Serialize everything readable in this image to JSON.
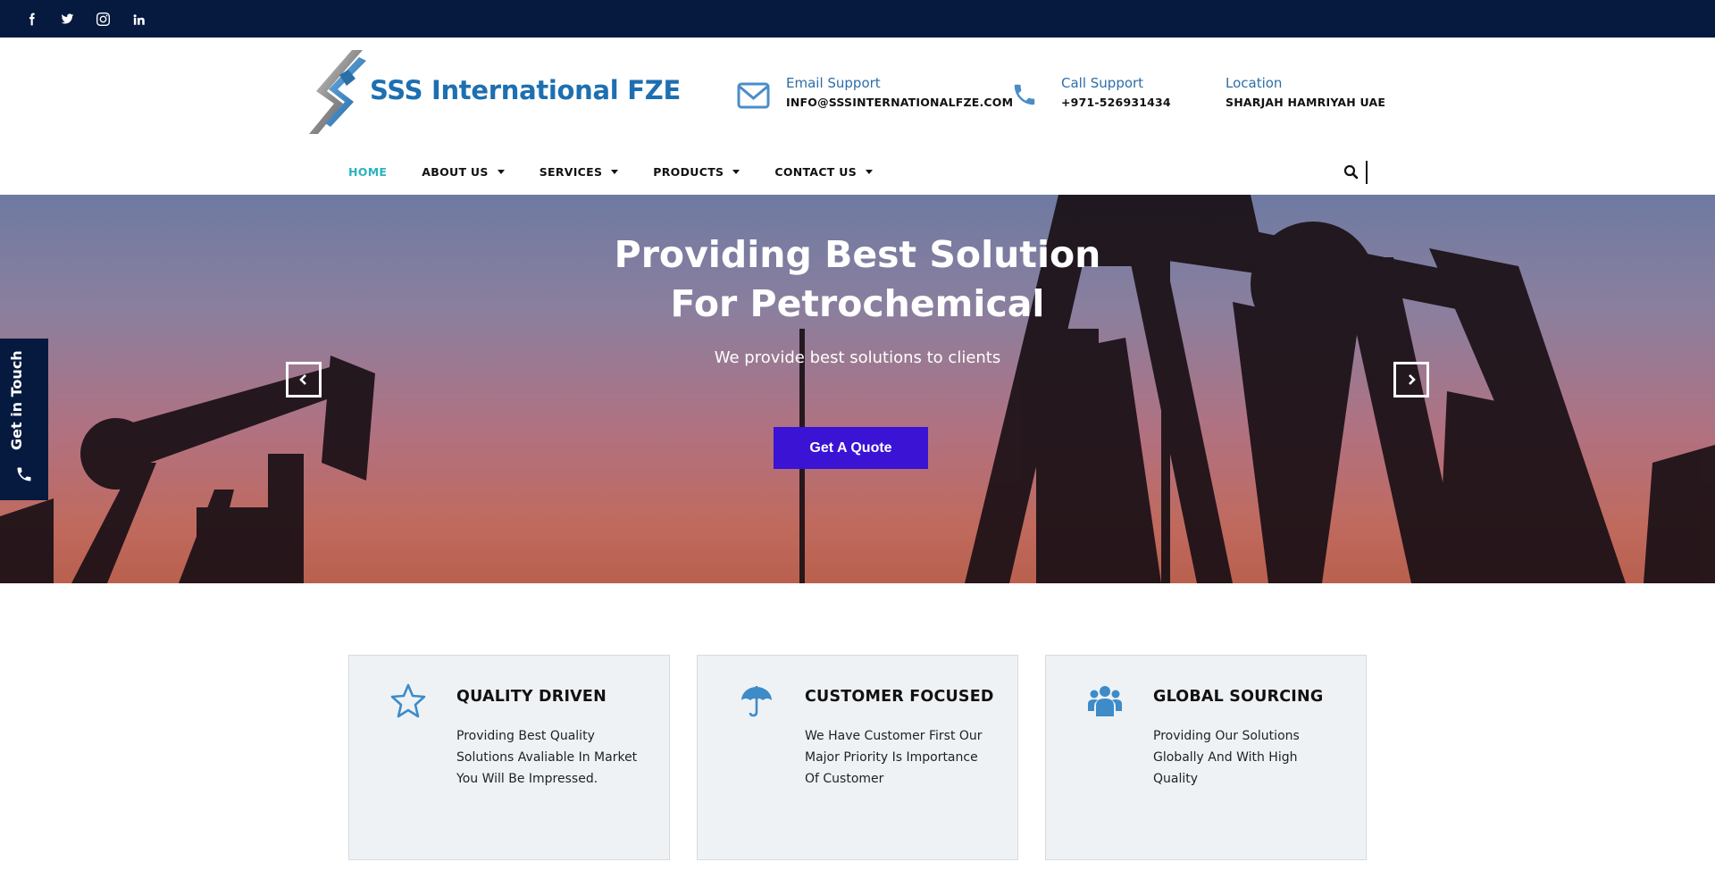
{
  "social": [
    {
      "name": "facebook-icon"
    },
    {
      "name": "twitter-icon"
    },
    {
      "name": "instagram-icon"
    },
    {
      "name": "linkedin-icon"
    }
  ],
  "brand": {
    "name": "SSS International FZE"
  },
  "contacts": {
    "email": {
      "label": "Email Support",
      "value": "INFO@SSSINTERNATIONALFZE.COM",
      "icon": "envelope-icon"
    },
    "phone": {
      "label": "Call Support",
      "value": "+971-526931434",
      "icon": "phone-icon"
    },
    "location": {
      "label": "Location",
      "value": "SHARJAH HAMRIYAH UAE"
    }
  },
  "nav": {
    "items": [
      {
        "label": "HOME",
        "active": true,
        "dropdown": false
      },
      {
        "label": "ABOUT US",
        "active": false,
        "dropdown": true
      },
      {
        "label": "SERVICES",
        "active": false,
        "dropdown": true
      },
      {
        "label": "PRODUCTS",
        "active": false,
        "dropdown": true
      },
      {
        "label": "CONTACT US",
        "active": false,
        "dropdown": true
      }
    ]
  },
  "hero": {
    "title_line1": "Providing Best Solution",
    "title_line2": "For Petrochemical",
    "subtitle": "We provide best solutions to clients",
    "cta": "Get A Quote"
  },
  "side_tab": {
    "label": "Get in Touch"
  },
  "features": [
    {
      "title": "QUALITY DRIVEN",
      "text": "Providing Best Quality Solutions Avaliable In Market You Will Be Impressed.",
      "icon": "star-icon"
    },
    {
      "title": "CUSTOMER FOCUSED",
      "text": "We Have Customer First Our Major Priority Is Importance Of Customer",
      "icon": "umbrella-icon"
    },
    {
      "title": "GLOBAL SOURCING",
      "text": "Providing Our Solutions Globally And With High Quality",
      "icon": "users-icon"
    }
  ],
  "colors": {
    "topbar": "#061a3f",
    "brand_blue": "#1d6fb1",
    "nav_active": "#2ab3c0",
    "cta": "#3a13d4",
    "feature_bg": "#eff2f5",
    "icon_blue": "#3d8bc9"
  }
}
